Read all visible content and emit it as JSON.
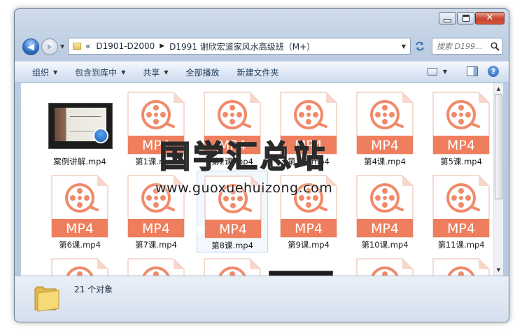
{
  "window": {
    "close_glyph": "✕"
  },
  "nav": {
    "back_glyph": "◀",
    "breadcrumb_prefix": "«",
    "breadcrumbs": [
      "D1901-D2000",
      "D1991 谢欣宏道家风水高级班（M+）"
    ],
    "search_placeholder": "搜索 D199...",
    "refresh_icon": "refresh-icon",
    "search_icon": "search-icon"
  },
  "toolbar": {
    "organize": "组织",
    "include_in_library": "包含到库中",
    "share": "共享",
    "play_all": "全部播放",
    "new_folder": "新建文件夹",
    "help_glyph": "?"
  },
  "files": [
    {
      "name": "案例讲解.mp4",
      "kind": "video-thumbnail"
    },
    {
      "name": "第1课.mp4",
      "kind": "mp4"
    },
    {
      "name": "第2课.mp4",
      "kind": "mp4"
    },
    {
      "name": "第3课.mp4",
      "kind": "mp4"
    },
    {
      "name": "第4课.mp4",
      "kind": "mp4"
    },
    {
      "name": "第5课.mp4",
      "kind": "mp4"
    },
    {
      "name": "第6课.mp4",
      "kind": "mp4"
    },
    {
      "name": "第7课.mp4",
      "kind": "mp4"
    },
    {
      "name": "第8课.mp4",
      "kind": "mp4",
      "selected": true
    },
    {
      "name": "第9课.mp4",
      "kind": "mp4"
    },
    {
      "name": "第10课.mp4",
      "kind": "mp4"
    },
    {
      "name": "第11课.mp4",
      "kind": "mp4"
    },
    {
      "name": "",
      "kind": "mp4"
    },
    {
      "name": "",
      "kind": "mp4"
    },
    {
      "name": "",
      "kind": "mp4"
    },
    {
      "name": "",
      "kind": "video-thumbnail"
    },
    {
      "name": "",
      "kind": "mp4"
    },
    {
      "name": "",
      "kind": "mp4"
    }
  ],
  "mp4_badge_text": "MP4",
  "status": {
    "count_text": "21 个对象"
  },
  "watermark": {
    "title": "国学汇总站",
    "url": "www.guoxuehuizong.com"
  },
  "colors": {
    "mp4_orange": "#f08a6a",
    "mp4_badge": "#ee7e5d",
    "toolbar_text": "#1e3a5c",
    "selection_border": "#b9d5f3"
  }
}
